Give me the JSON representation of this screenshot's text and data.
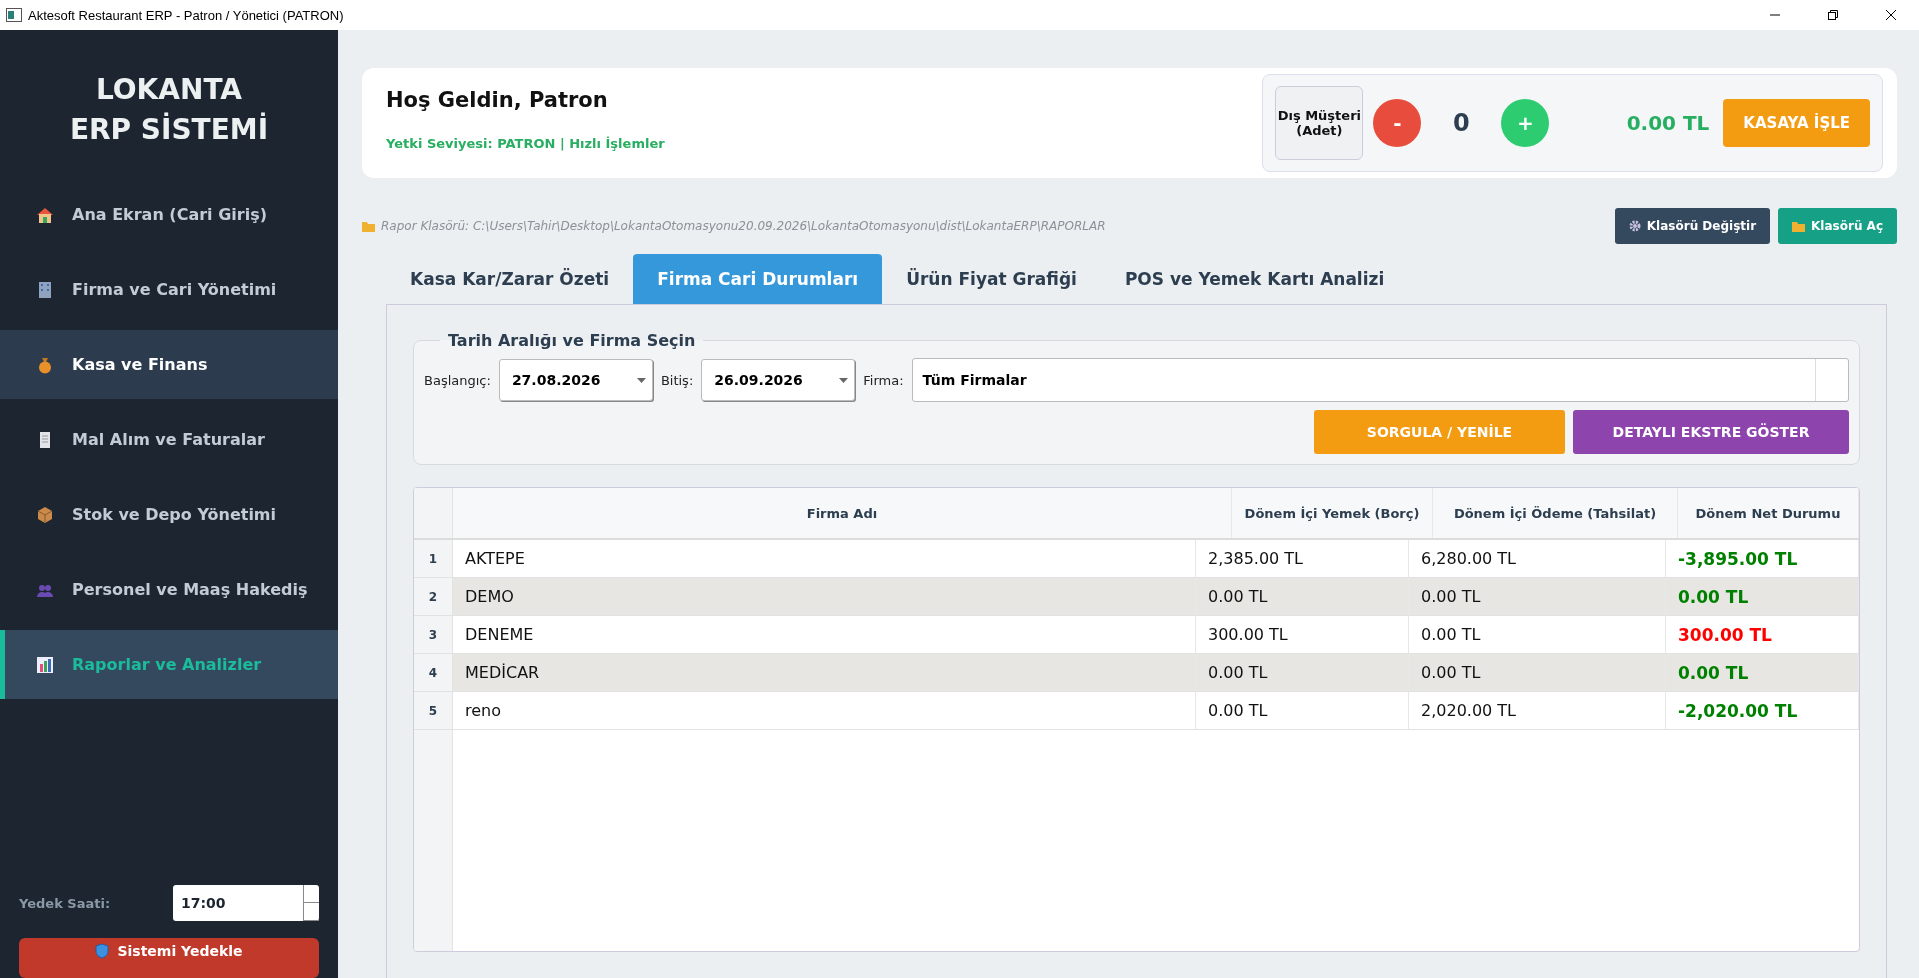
{
  "window": {
    "title": "Aktesoft Restaurant ERP - Patron / Yönetici (PATRON)"
  },
  "sidebar": {
    "logo_lines": [
      "LOKANTA",
      "ERP SİSTEMİ"
    ],
    "items": [
      {
        "label": "Ana Ekran (Cari Giriş)",
        "kind": "house",
        "selected": false,
        "hovered": false
      },
      {
        "label": "Firma ve Cari Yönetimi",
        "kind": "building",
        "selected": false,
        "hovered": false
      },
      {
        "label": "Kasa ve Finans",
        "kind": "bag",
        "selected": false,
        "hovered": true
      },
      {
        "label": "Mal Alım ve Faturalar",
        "kind": "receipt",
        "selected": false,
        "hovered": false
      },
      {
        "label": "Stok ve Depo Yönetimi",
        "kind": "box",
        "selected": false,
        "hovered": false
      },
      {
        "label": "Personel ve Maaş Hakediş",
        "kind": "people",
        "selected": false,
        "hovered": false
      },
      {
        "label": "Raporlar ve Analizler",
        "kind": "chart",
        "selected": true,
        "hovered": false
      }
    ],
    "backup_label": "Yedek Saati:",
    "backup_time": "17:00",
    "backup_button": "Sistemi Yedekle"
  },
  "header": {
    "greeting": "Hoş Geldin, Patron",
    "subtitle": "Yetki Seviyesi: PATRON | Hızlı İşlemler",
    "counter_label": "Dış Müşteri (Adet)",
    "minus": "-",
    "count": "0",
    "plus": "+",
    "total": "0.00 TL",
    "submit": "KASAYA İŞLE"
  },
  "folder": {
    "path": "Rapor Klasörü: C:\\Users\\Tahir\\Desktop\\LokantaOtomasyonu20.09.2026\\LokantaOtomasyonu\\dist\\LokantaERP\\RAPORLAR",
    "change_button": "Klasörü Değiştir",
    "open_button": "Klasörü Aç"
  },
  "tabs": [
    {
      "label": "Kasa Kar/Zarar Özeti",
      "selected": false
    },
    {
      "label": "Firma Cari Durumları",
      "selected": true
    },
    {
      "label": "Ürün Fiyat Grafiği",
      "selected": false
    },
    {
      "label": "POS ve Yemek Kartı Analizi",
      "selected": false
    }
  ],
  "filter": {
    "title": "Tarih Aralığı ve Firma Seçin",
    "start_label": "Başlangıç:",
    "start": "27.08.2026",
    "end_label": "Bitiş:",
    "end": "26.09.2026",
    "firm_label": "Firma:",
    "firm": "Tüm Firmalar",
    "query_button": "SORGULA / YENİLE",
    "detail_button": "DETAYLI EKSTRE GÖSTER"
  },
  "table": {
    "columns": [
      "Firma Adı",
      "Dönem İçi Yemek (Borç)",
      "Dönem İçi Ödeme (Tahsilat)",
      "Dönem Net Durumu"
    ],
    "rows": [
      {
        "index": "1",
        "cells": [
          "AKTEPE",
          "2,385.00 TL",
          "6,280.00 TL",
          "-3,895.00 TL"
        ],
        "color": "#008000"
      },
      {
        "index": "2",
        "cells": [
          "DEMO",
          "0.00 TL",
          "0.00 TL",
          "0.00 TL"
        ],
        "color": "#008000"
      },
      {
        "index": "3",
        "cells": [
          "DENEME",
          "300.00 TL",
          "0.00 TL",
          "300.00 TL"
        ],
        "color": "#ff0000"
      },
      {
        "index": "4",
        "cells": [
          "MEDİCAR",
          "0.00 TL",
          "0.00 TL",
          "0.00 TL"
        ],
        "color": "#008000"
      },
      {
        "index": "5",
        "cells": [
          "reno",
          "0.00 TL",
          "2,020.00 TL",
          "-2,020.00 TL"
        ],
        "color": "#008000"
      }
    ]
  }
}
